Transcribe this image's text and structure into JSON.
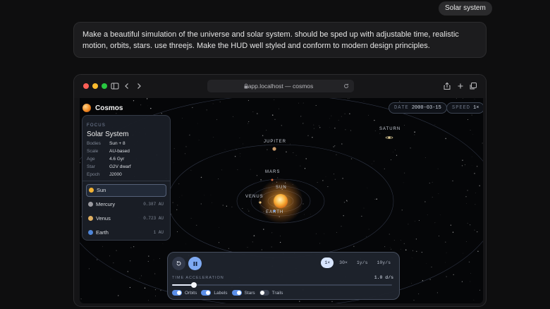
{
  "chat": {
    "chip": "Solar system",
    "prompt": "Make a beautiful simulation of the universe and solar system. should be sped up with adjustable time, realistic motion, orbits, stars. use threejs. Make the HUD well styled and conform to modern design principles."
  },
  "browser": {
    "url": "app.localhost — cosmos",
    "icons": [
      "sidebar-icon",
      "back-icon",
      "forward-icon",
      "lock-icon",
      "reload-icon",
      "share-icon",
      "new-tab-icon",
      "tabs-icon"
    ]
  },
  "app": {
    "name": "Cosmos",
    "date_label": "DATE",
    "date_value": "2000-03-15",
    "speed_label": "SPEED",
    "speed_value": "1×"
  },
  "focus": {
    "label": "FOCUS",
    "title": "Solar System",
    "rows": [
      {
        "key": "Bodies",
        "value": "Sun + 8"
      },
      {
        "key": "Scale",
        "value": "AU-based"
      },
      {
        "key": "Age",
        "value": "4.6 Gyr"
      },
      {
        "key": "Star",
        "value": "G2V dwarf"
      },
      {
        "key": "Epoch",
        "value": "J2000"
      }
    ],
    "bodies": [
      {
        "name": "Sun",
        "dist": "",
        "color": "#f2b233"
      },
      {
        "name": "Mercury",
        "dist": "0.387 AU",
        "color": "#9a9aa0"
      },
      {
        "name": "Venus",
        "dist": "0.723 AU",
        "color": "#e0b063"
      },
      {
        "name": "Earth",
        "dist": "1 AU",
        "color": "#4f86d9"
      }
    ]
  },
  "scene": {
    "labels": {
      "saturn": "SATURN",
      "jupiter": "JUPITER",
      "mars": "MARS",
      "sun": "SUN",
      "venus": "VENUS",
      "earth": "EARTH"
    }
  },
  "controls": {
    "speeds": [
      "1×",
      "30×",
      "1y/s",
      "10y/s"
    ],
    "active_speed": "1×",
    "accel_label": "TIME ACCELERATION",
    "accel_value": "1.0 d/s",
    "accel_fraction": 0.1,
    "toggles": [
      {
        "label": "Orbits",
        "on": true
      },
      {
        "label": "Labels",
        "on": true
      },
      {
        "label": "Stars",
        "on": true
      },
      {
        "label": "Trails",
        "on": false
      }
    ]
  }
}
